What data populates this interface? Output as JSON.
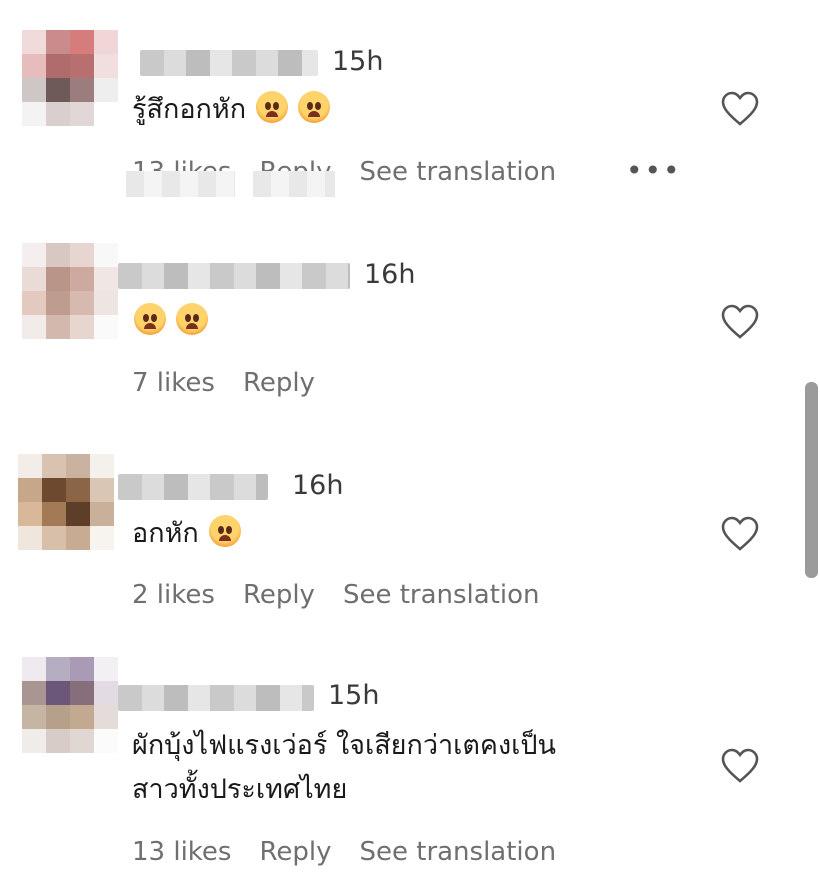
{
  "comments": [
    {
      "time": "15h",
      "text": "รู้สึกอกหัก",
      "emojis": [
        "pleading-face",
        "pleading-face"
      ],
      "likes": "13 likes",
      "reply": "Reply",
      "translate": "See translation",
      "more": "•••",
      "avatar_colors": [
        "#f1dada",
        "#c98b8b",
        "#d77c7c",
        "#f0d6d6",
        "#e6bcbc",
        "#b06c6c",
        "#b86f6f",
        "#f1dede",
        "#cfc6c6",
        "#6f5a5a",
        "#9b7d7d",
        "#eeeeee",
        "#f3f3f3",
        "#d9cfcf",
        "#e1d7d7",
        "#ffffff"
      ]
    },
    {
      "time": "16h",
      "text": "",
      "emojis": [
        "pleading-face",
        "pleading-face"
      ],
      "likes": "7 likes",
      "reply": "Reply",
      "avatar_colors": [
        "#f4eeee",
        "#d9c7c1",
        "#e6d5d0",
        "#f8f8f8",
        "#e9dbd6",
        "#b99488",
        "#cda99f",
        "#f0e7e4",
        "#e3c9c0",
        "#bf9c90",
        "#d7b9af",
        "#ece5e2",
        "#f1ebe9",
        "#d3b8ae",
        "#e7d6d0",
        "#fafafa"
      ]
    },
    {
      "time": "16h",
      "text": "อกหัก",
      "emojis": [
        "pleading-face"
      ],
      "likes": "2 likes",
      "reply": "Reply",
      "translate": "See translation",
      "avatar_colors": [
        "#f2ede8",
        "#d8c3b0",
        "#c9b3a0",
        "#f4f0ec",
        "#c6a789",
        "#6d4a2f",
        "#8b6546",
        "#d9c6b5",
        "#d9b89a",
        "#a27a56",
        "#5c3e29",
        "#c9b09b",
        "#efe6dd",
        "#d7bfa9",
        "#c7ab92",
        "#f7f3ef"
      ]
    },
    {
      "time": "15h",
      "text_line1": "ผักบุ้งไฟแรงเว่อร์ ใจเสียกว่าเตคงเป็น",
      "text_line2": "สาวทั้งประเทศไทย",
      "likes": "13 likes",
      "reply": "Reply",
      "translate": "See translation",
      "avatar_colors": [
        "#efeaf0",
        "#b7adc2",
        "#a99bb5",
        "#f3f0f4",
        "#a99591",
        "#6b5878",
        "#876e7b",
        "#e2dbe3",
        "#c7b5a4",
        "#b69f8b",
        "#c2a98f",
        "#e4dcd8",
        "#f0ece9",
        "#d7ccc8",
        "#e0d6d2",
        "#fbfbfb"
      ]
    }
  ]
}
